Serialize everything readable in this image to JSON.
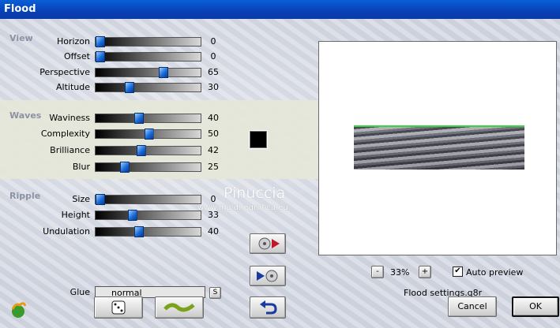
{
  "window": {
    "title": "Flood"
  },
  "groups": {
    "view": {
      "label": "View",
      "sliders": [
        {
          "label": "Horizon",
          "value": "0",
          "pos": 0
        },
        {
          "label": "Offset",
          "value": "0",
          "pos": 0
        },
        {
          "label": "Perspective",
          "value": "65",
          "pos": 65
        },
        {
          "label": "Altitude",
          "value": "30",
          "pos": 30
        }
      ]
    },
    "waves": {
      "label": "Waves",
      "sliders": [
        {
          "label": "Waviness",
          "value": "40",
          "pos": 40
        },
        {
          "label": "Complexity",
          "value": "50",
          "pos": 50
        },
        {
          "label": "Brilliance",
          "value": "42",
          "pos": 42
        },
        {
          "label": "Blur",
          "value": "25",
          "pos": 25
        }
      ]
    },
    "ripple": {
      "label": "Ripple",
      "sliders": [
        {
          "label": "Size",
          "value": "0",
          "pos": 0
        },
        {
          "label": "Height",
          "value": "33",
          "pos": 33
        },
        {
          "label": "Undulation",
          "value": "40",
          "pos": 40
        }
      ]
    }
  },
  "wave_color": "#000000",
  "glue": {
    "label": "Glue",
    "value": "normal",
    "s_label": "S"
  },
  "watermark": {
    "name": "Pinuccia",
    "url": "www.maidiregrafica.eu"
  },
  "preview": {
    "zoom_minus": "-",
    "zoom": "33%",
    "zoom_plus": "+",
    "auto_preview_label": "Auto preview",
    "auto_preview_checked": true,
    "settings_file": "Flood settings.q8r"
  },
  "buttons": {
    "cancel": "Cancel",
    "ok": "OK"
  },
  "icons": {
    "logo": "flood-logo-icon",
    "random": "dice-icon",
    "wave": "wave-icon",
    "undo": "undo-arrow-icon",
    "save": "save-preset-icon",
    "load": "load-preset-icon"
  }
}
